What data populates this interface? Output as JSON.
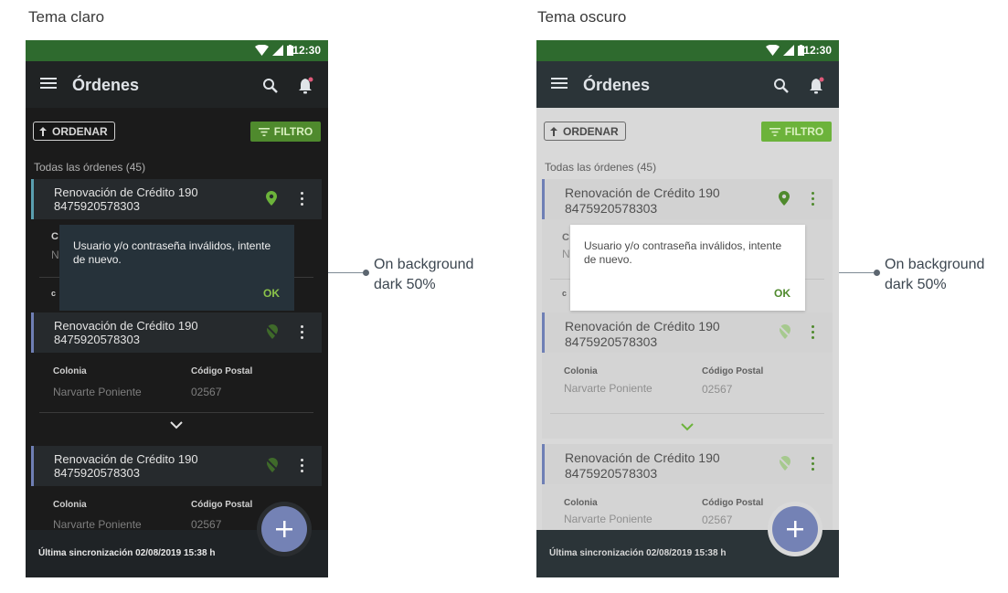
{
  "captions": {
    "left": "Tema claro",
    "right": "Tema oscuro"
  },
  "status_bar": {
    "time": "12:30"
  },
  "app_bar": {
    "title": "Órdenes"
  },
  "toolbar": {
    "sort_label": "ORDENAR",
    "filter_label": "FILTRO"
  },
  "list": {
    "section_label": "Todas las órdenes (45)",
    "cards": [
      {
        "title": "Renovación de Crédito 190",
        "number": "8475920578303",
        "location_set": true
      },
      {
        "title": "Renovación de Crédito 190",
        "number": "8475920578303",
        "location_set": false,
        "fields": [
          {
            "label": "Colonia",
            "value": "Narvarte Poniente"
          },
          {
            "label": "Código Postal",
            "value": "02567"
          }
        ]
      },
      {
        "title": "Renovación de Crédito 190",
        "number": "8475920578303",
        "location_set": false,
        "fields": [
          {
            "label": "Colonia",
            "value": "Narvarte Poniente"
          },
          {
            "label": "Código Postal",
            "value": "02567"
          }
        ]
      }
    ]
  },
  "dialog": {
    "message": "Usuario y/o contraseña inválidos, intente de nuevo.",
    "ok_label": "OK"
  },
  "footer": {
    "sync_text": "Última sincronización 02/08/2019 15:38 h"
  },
  "annotation": {
    "line1": "On background",
    "line2": "dark 50%"
  },
  "colors": {
    "accent_green": "#6cb33b",
    "status_green": "#2e6a2e",
    "fab": "#7482b5",
    "card_accent": "#6f7fb5"
  },
  "icons": [
    "menu-icon",
    "search-icon",
    "notification-bell-icon",
    "arrow-up-icon",
    "filter-icon",
    "location-pin-icon",
    "location-off-icon",
    "more-vert-icon",
    "chevron-down-icon",
    "add-icon",
    "wifi-icon",
    "signal-icon",
    "battery-icon"
  ]
}
